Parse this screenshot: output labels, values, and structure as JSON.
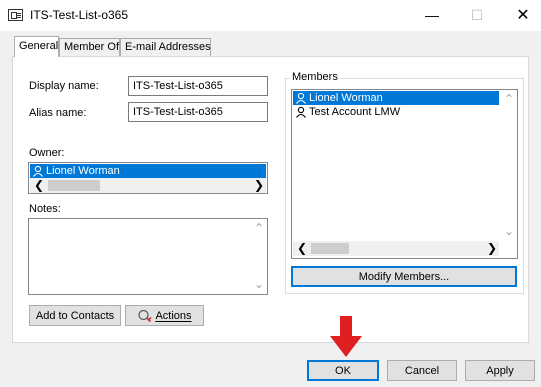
{
  "window": {
    "title": "ITS-Test-List-o365",
    "minimize": "—",
    "maximize": "☐",
    "close": "✕"
  },
  "tabs": [
    {
      "label": "General"
    },
    {
      "label": "Member Of"
    },
    {
      "label": "E-mail Addresses"
    }
  ],
  "general": {
    "display_name_label": "Display name:",
    "display_name_value": "ITS-Test-List-o365",
    "alias_name_label": "Alias name:",
    "alias_name_value": "ITS-Test-List-o365",
    "owner_label": "Owner:",
    "owner_items": [
      "Lionel Worman"
    ],
    "notes_label": "Notes:",
    "notes_value": ""
  },
  "members": {
    "group_title": "Members",
    "items": [
      "Lionel Worman",
      "Test Account LMW"
    ],
    "modify_button": "Modify Members..."
  },
  "buttons": {
    "add_to_contacts": "Add to Contacts",
    "actions": "Actions",
    "ok": "OK",
    "cancel": "Cancel",
    "apply": "Apply"
  },
  "colors": {
    "selection": "#0078d7",
    "annotation_arrow": "#e02020"
  }
}
